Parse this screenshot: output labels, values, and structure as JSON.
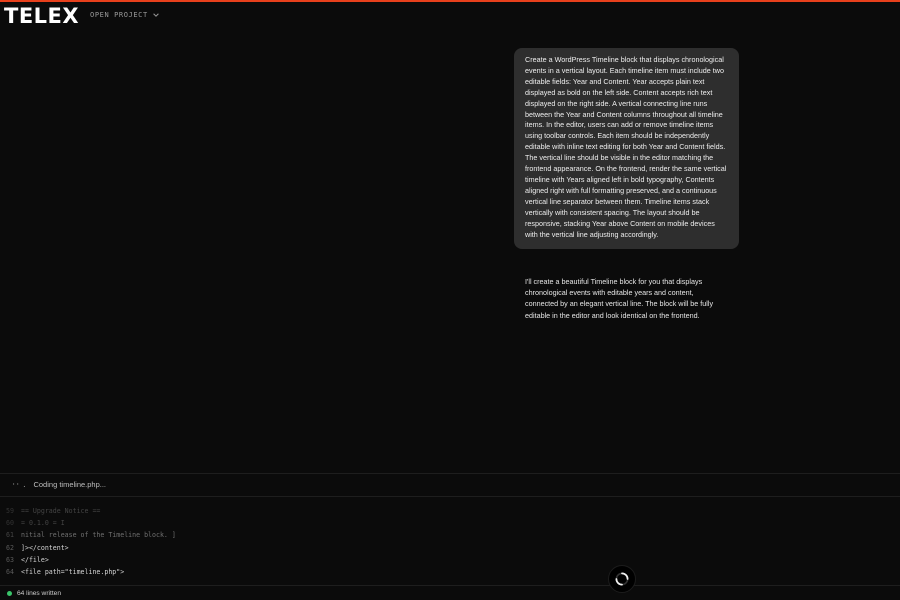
{
  "app": {
    "logo": "TELEX",
    "project_menu_label": "OPEN PROJECT",
    "accent_color": "#e8401c"
  },
  "chat": {
    "user_message": "Create a WordPress Timeline block that displays chronological events in a vertical layout. Each timeline item must include two editable fields: Year and Content. Year accepts plain text displayed as bold on the left side. Content accepts rich text displayed on the right side. A vertical connecting line runs between the Year and Content columns throughout all timeline items. In the editor, users can add or remove timeline items using toolbar controls. Each item should be independently editable with inline text editing for both Year and Content fields. The vertical line should be visible in the editor matching the frontend appearance. On the frontend, render the same vertical timeline with Years aligned left in bold typography, Contents aligned right with full formatting preserved, and a continuous vertical line separator between them. Timeline items stack vertically with consistent spacing. The layout should be responsive, stacking Year above Content on mobile devices with the vertical line adjusting accordingly.",
    "assistant_message": "I'll create a beautiful Timeline block for you that displays chronological events with editable years and content, connected by an elegant vertical line. The block will be fully editable in the editor and look identical on the frontend."
  },
  "status": {
    "spinner": "⠐⠂.",
    "text": "Coding timeline.php..."
  },
  "code_lines": [
    {
      "num": "59",
      "text": "== Upgrade Notice ==",
      "style": "faded"
    },
    {
      "num": "60",
      "text": "= 0.1.0 = I",
      "style": "faded"
    },
    {
      "num": "61",
      "text": "nitial release of the Timeline block. ]",
      "style": "semi"
    },
    {
      "num": "62",
      "text": "]></content>",
      "style": "normal"
    },
    {
      "num": "63",
      "text": "</file>",
      "style": "normal"
    },
    {
      "num": "64",
      "text": "<file path=\"timeline.php\">",
      "style": "normal"
    }
  ],
  "footer": {
    "status_text": "64 lines written",
    "status_color": "#3ac46a"
  }
}
